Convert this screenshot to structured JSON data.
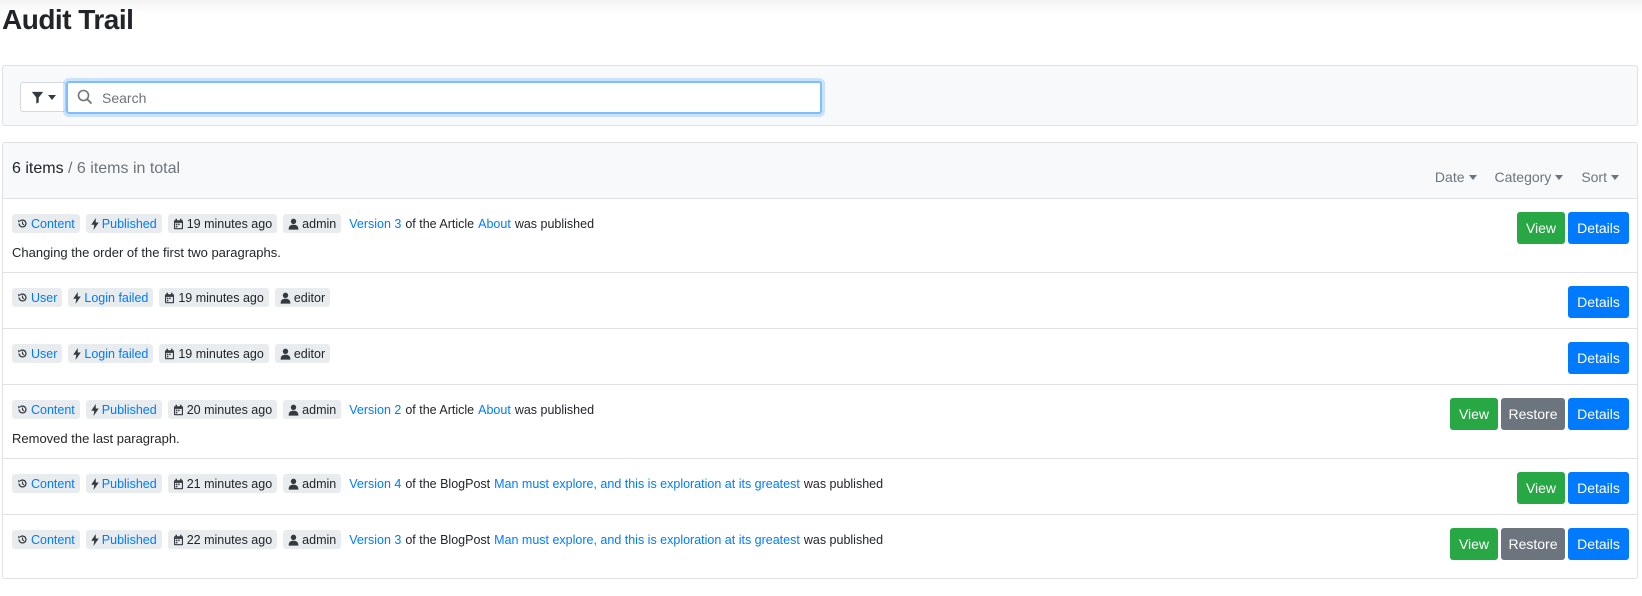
{
  "page": {
    "title": "Audit Trail"
  },
  "filter": {
    "placeholder": "Search"
  },
  "list": {
    "count": "6 items",
    "total": "/ 6 items in total",
    "sort_options": [
      "Date",
      "Category",
      "Sort"
    ]
  },
  "rows": [
    {
      "category": "Content",
      "event": "Published",
      "time": "19 minutes ago",
      "user": "admin",
      "version": "Version 3",
      "of_text": "of the Article",
      "item": "About",
      "suffix": "was published",
      "description": "Changing the order of the first two paragraphs.",
      "buttons": [
        "View",
        "Details"
      ]
    },
    {
      "category": "User",
      "event": "Login failed",
      "time": "19 minutes ago",
      "user": "editor",
      "buttons": [
        "Details"
      ]
    },
    {
      "category": "User",
      "event": "Login failed",
      "time": "19 minutes ago",
      "user": "editor",
      "buttons": [
        "Details"
      ]
    },
    {
      "category": "Content",
      "event": "Published",
      "time": "20 minutes ago",
      "user": "admin",
      "version": "Version 2",
      "of_text": "of the Article",
      "item": "About",
      "suffix": "was published",
      "description": "Removed the last paragraph.",
      "buttons": [
        "View",
        "Restore",
        "Details"
      ]
    },
    {
      "category": "Content",
      "event": "Published",
      "time": "21 minutes ago",
      "user": "admin",
      "version": "Version 4",
      "of_text": "of the BlogPost",
      "item": "Man must explore, and this is exploration at its greatest",
      "suffix": "was published",
      "buttons": [
        "View",
        "Details"
      ]
    },
    {
      "category": "Content",
      "event": "Published",
      "time": "22 minutes ago",
      "user": "admin",
      "version": "Version 3",
      "of_text": "of the BlogPost",
      "item": "Man must explore, and this is exploration at its greatest",
      "suffix": "was published",
      "buttons": [
        "View",
        "Restore",
        "Details"
      ]
    }
  ],
  "colors": {
    "primary": "#007bff",
    "success": "#28a745",
    "secondary": "#6c757d",
    "badge_bg": "#e9ecef"
  }
}
